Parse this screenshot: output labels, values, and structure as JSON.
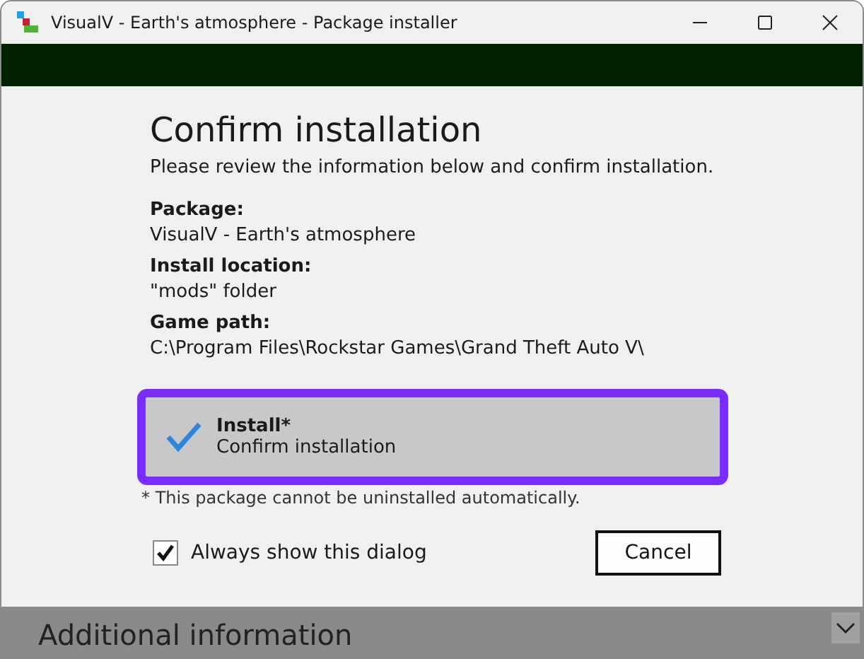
{
  "window": {
    "title": "VisualV - Earth's atmosphere - Package installer"
  },
  "heading": "Confirm installation",
  "intro": "Please review the information below and confirm installation.",
  "fields": [
    {
      "label": "Package:",
      "value": "VisualV - Earth's atmosphere"
    },
    {
      "label": "Install location:",
      "value": "\"mods\" folder"
    },
    {
      "label": "Game path:",
      "value": "C:\\Program Files\\Rockstar Games\\Grand Theft Auto V\\"
    }
  ],
  "install_option": {
    "title": "Install*",
    "subtitle": "Confirm installation",
    "selected": true
  },
  "footnote": "* This package cannot be uninstalled automatically.",
  "always_show": {
    "label": "Always show this dialog",
    "checked": true
  },
  "cancel_button": "Cancel",
  "additional_panel": {
    "title": "Additional information",
    "expanded": false
  }
}
